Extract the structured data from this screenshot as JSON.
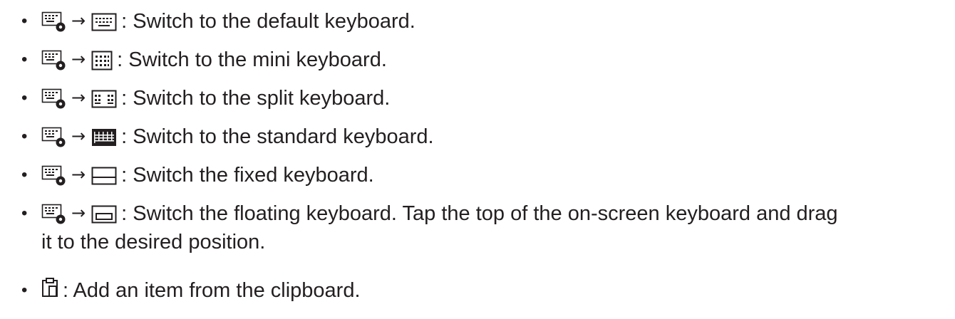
{
  "items": [
    {
      "bullet": "•",
      "arrow": "→",
      "icon": "keyboard-settings-icon",
      "target_icon": "default-keyboard-icon",
      "text": ": Switch to the default keyboard."
    },
    {
      "bullet": "•",
      "arrow": "→",
      "icon": "keyboard-settings-icon",
      "target_icon": "mini-keyboard-icon",
      "text": ": Switch to the mini keyboard."
    },
    {
      "bullet": "•",
      "arrow": "→",
      "icon": "keyboard-settings-icon",
      "target_icon": "split-keyboard-icon",
      "text": ": Switch to the split keyboard."
    },
    {
      "bullet": "•",
      "arrow": "→",
      "icon": "keyboard-settings-icon",
      "target_icon": "standard-keyboard-icon",
      "text": ": Switch to the standard keyboard."
    },
    {
      "bullet": "•",
      "arrow": "→",
      "icon": "keyboard-settings-icon",
      "target_icon": "fixed-keyboard-icon",
      "text": ": Switch the fixed keyboard."
    },
    {
      "bullet": "•",
      "arrow": "→",
      "icon": "keyboard-settings-icon",
      "target_icon": "floating-keyboard-icon",
      "text": ": Switch the floating keyboard. Tap the top of the on-screen keyboard and drag",
      "text_continued": "it to the desired position."
    },
    {
      "bullet": "•",
      "icon": "clipboard-icon",
      "text": ": Add an item from the clipboard."
    }
  ]
}
